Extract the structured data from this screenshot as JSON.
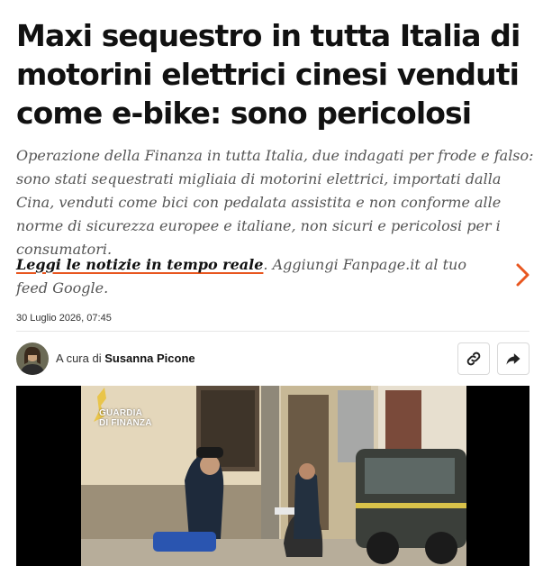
{
  "article": {
    "headline": "Maxi sequestro in tutta Italia di motorini elettrici cinesi venduti come e-bike: sono pericolosi",
    "summary": "Operazione della Finanza in tutta Italia, due indagati per frode e falso: sono stati sequestrati migliaia di motorini elettrici, importati dalla Cina, venduti come bici con pedalata assistita e non conforme alle norme di sicurezza europee e italiane, non sicuri e pericolosi per i consumatori.",
    "cta": {
      "link_text": "Leggi le notizie in tempo reale",
      "rest_text": ". Aggiungi Fanpage.it al tuo feed Google."
    },
    "date": "30 Luglio 2026, 07:45",
    "byline": {
      "prefix": "A cura di",
      "author": "Susanna Picone"
    }
  },
  "actions": {
    "copy_link_icon": "link-icon",
    "share_icon": "share-icon",
    "chevron_icon": "chevron-right-icon"
  },
  "video": {
    "logo_line1": "GUARDIA",
    "logo_line2": "DI FINANZA"
  },
  "colors": {
    "accent": "#e8561f",
    "text": "#111111",
    "muted": "#555555"
  }
}
